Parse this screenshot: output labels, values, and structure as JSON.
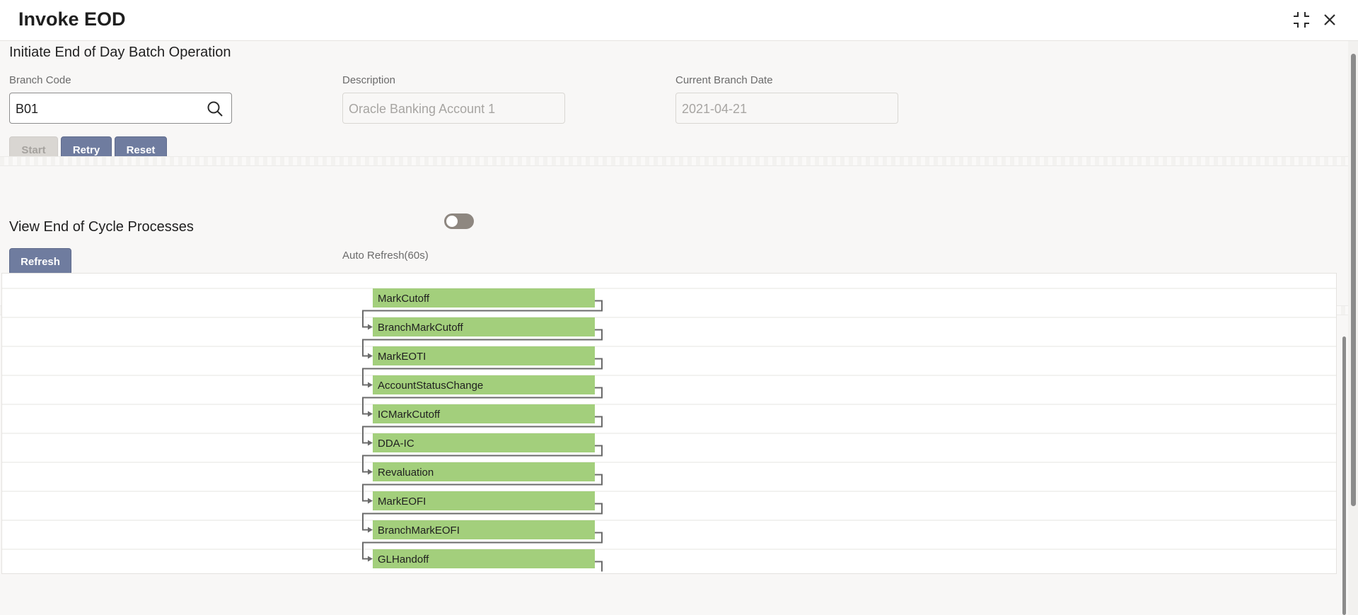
{
  "window": {
    "title": "Invoke EOD",
    "icons": {
      "compress": "compress-icon",
      "close": "close-icon"
    }
  },
  "initiate": {
    "section_title": "Initiate End of Day Batch Operation",
    "branch_code": {
      "label": "Branch Code",
      "value": "B01"
    },
    "description": {
      "label": "Description",
      "value": "Oracle Banking Account 1"
    },
    "current_branch_date": {
      "label": "Current Branch Date",
      "value": "2021-04-21"
    },
    "buttons": {
      "start": "Start",
      "retry": "Retry",
      "reset": "Reset"
    }
  },
  "view": {
    "section_title": "View End of Cycle Processes",
    "refresh_label": "Refresh",
    "auto_refresh_label": "Auto Refresh(60s)",
    "auto_refresh_on": false
  },
  "processes": [
    "MarkCutoff",
    "BranchMarkCutoff",
    "MarkEOTI",
    "AccountStatusChange",
    "ICMarkCutoff",
    "DDA-IC",
    "Revaluation",
    "MarkEOFI",
    "BranchMarkEOFI",
    "GLHandoff"
  ],
  "colors": {
    "process_node": "#a3cf7c",
    "connector": "#6b6b6b",
    "primary_button": "#6f7c9f"
  }
}
